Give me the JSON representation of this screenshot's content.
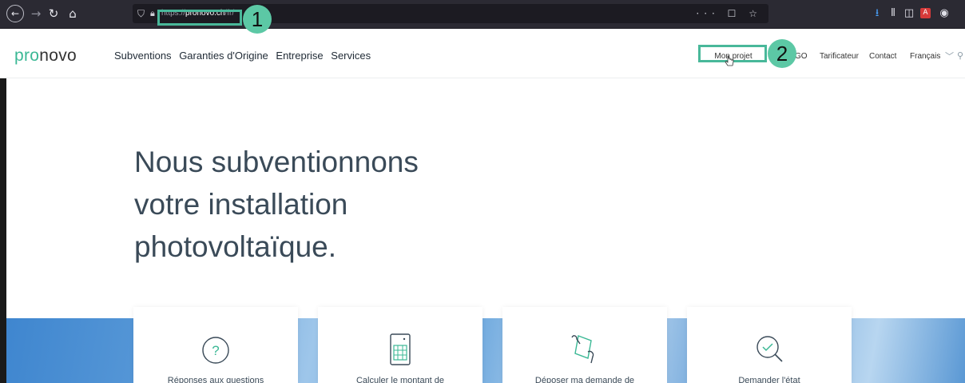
{
  "browser": {
    "url_prefix": "https://",
    "url_host": "pronovo.ch",
    "url_path": "/fr/",
    "overflow_icons": "··· ☐ ☆"
  },
  "annotations": {
    "step1": "1",
    "step2": "2"
  },
  "header": {
    "logo_accent": "pro",
    "logo_rest": "novo",
    "nav": [
      "Subventions",
      "Garanties d'Origine",
      "Entreprise",
      "Services"
    ],
    "project_link": "Mon projet",
    "go_link": "GO",
    "tarificateur": "Tarificateur",
    "contact": "Contact",
    "language": "Français"
  },
  "hero": {
    "line1": "Nous subventionnons",
    "line2": "votre installation",
    "line3": "photovoltaïque."
  },
  "cards": [
    {
      "label": "Réponses aux questions",
      "icon": "question-circle-icon"
    },
    {
      "label": "Calculer le montant de",
      "icon": "calculator-icon"
    },
    {
      "label": "Déposer ma demande de",
      "icon": "hand-document-icon"
    },
    {
      "label": "Demander l'état",
      "icon": "magnifier-check-icon"
    }
  ],
  "colors": {
    "accent": "#3bb895",
    "annotation": "#5cc8a5",
    "text": "#3a4a58"
  }
}
